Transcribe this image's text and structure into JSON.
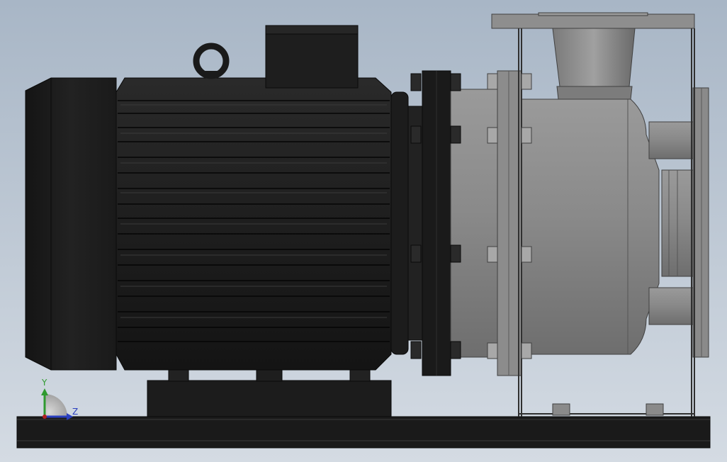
{
  "viewport": {
    "background_top": "#a8b6c6",
    "background_bottom": "#d4dbe3"
  },
  "model": {
    "motor_color": "#1f1f1f",
    "pump_color": "#8e8e8e",
    "baseplate_color": "#1a1a1a"
  },
  "triad": {
    "y_label": "Y",
    "z_label": "Z",
    "y_color": "#2f9a2f",
    "z_color": "#2a3fbf",
    "x_color": "#b02020"
  }
}
